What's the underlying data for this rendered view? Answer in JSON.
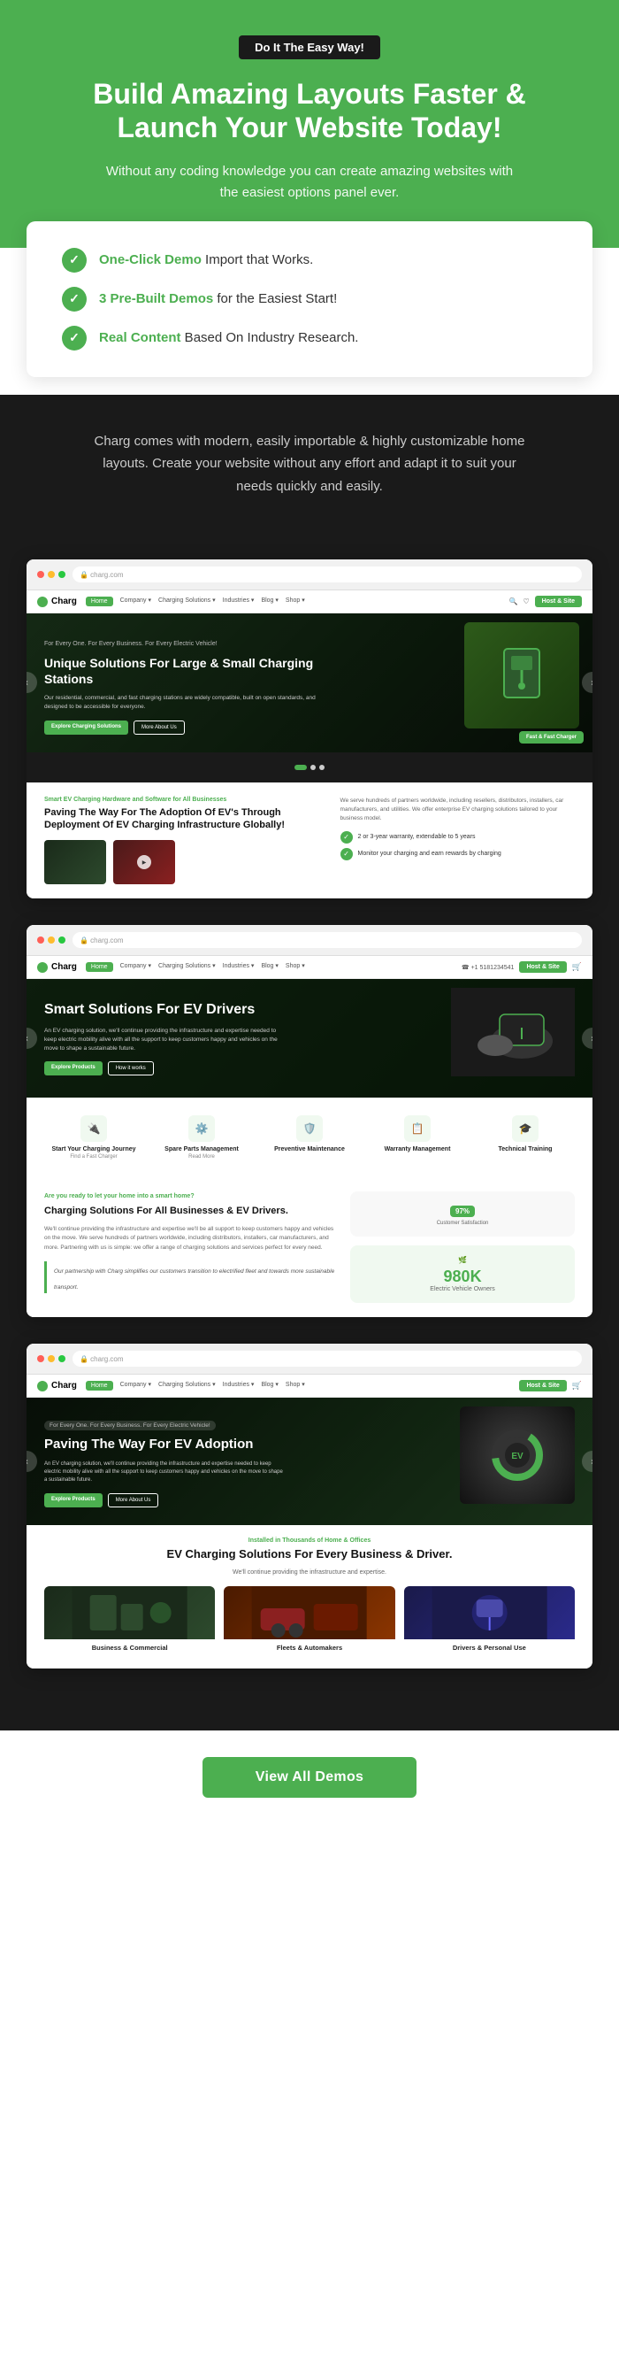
{
  "hero": {
    "badge": "Do It The Easy Way!",
    "title": "Build Amazing Layouts Faster & Launch Your Website Today!",
    "subtitle": "Without any coding knowledge you can create amazing websites with the easiest options panel ever."
  },
  "features": {
    "items": [
      {
        "highlight": "One-Click Demo",
        "text": " Import that Works."
      },
      {
        "highlight": "3 Pre-Built Demos",
        "text": " for the Easiest Start!"
      },
      {
        "highlight": "Real Content",
        "text": " Based On Industry Research."
      }
    ]
  },
  "dark_description": "Charg comes with modern, easily importable & highly customizable home layouts. Create your website without any effort and adapt it to suit your needs quickly and easily.",
  "demos": [
    {
      "id": "demo1",
      "nav": {
        "logo": "Charg",
        "links": [
          "Home",
          "Company",
          "Charging Solutions",
          "Industries",
          "Blog",
          "Shop"
        ],
        "active_link": "Home",
        "right_items": [
          "Search",
          "Host & Site"
        ]
      },
      "hero": {
        "small_text": "For Every One. For Every Business. For Every Electric Vehicle!",
        "title": "Unique Solutions For Large & Small Charging Stations",
        "body": "Our residential, commercial, and fast charging stations are widely compatible, built on open standards, and designed to be accessible for everyone.",
        "btn1": "Explore Charging Solutions",
        "btn2": "More About Us"
      },
      "section2": {
        "label": "Smart EV Charging Hardware and Software for All Businesses",
        "title": "Paving The Way For The Adoption Of EV's Through Deployment Of EV Charging Infrastructure Globally!",
        "body": "We serve hundreds of partners worldwide, including resellers, distributors, installers, car manufacturers, and utilities. We offer enterprise EV charging solutions tailored to your business model.",
        "checks": [
          "2 or 3-year warranty, extendable to 5 years",
          "Monitor your charging and earn rewards by charging"
        ]
      }
    },
    {
      "id": "demo2",
      "nav": {
        "logo": "Charg",
        "links": [
          "Home",
          "Company",
          "Charging Solutions",
          "Industries",
          "Blog",
          "Shop"
        ],
        "active_link": "Home",
        "right_items": [
          "+1 5181234541",
          "Host & Site"
        ]
      },
      "hero": {
        "title": "Smart Solutions For EV Drivers",
        "body": "An EV charging solution, we'll continue providing the infrastructure and expertise needed to keep electric mobility alive with all the support to keep customers happy and vehicles on the move to shape a sustainable future.",
        "btn1": "Explore Products",
        "btn2": "How it works"
      },
      "cards": [
        {
          "icon": "🔧",
          "title": "Start Your Charging Journey",
          "desc": "Find a Fast Charger"
        },
        {
          "icon": "⚙️",
          "title": "Spare Parts Management",
          "desc": "Read More"
        },
        {
          "icon": "🛡️",
          "title": "Preventive Maintenance",
          "desc": ""
        },
        {
          "icon": "📋",
          "title": "Warranty Management",
          "desc": ""
        },
        {
          "icon": "🎓",
          "title": "Technical Training",
          "desc": ""
        }
      ],
      "section2": {
        "label": "Are you ready to let your home into a smart home?",
        "title": "Charging Solutions For All Businesses & EV Drivers.",
        "body": "We'll continue providing the infrastructure and expertise we'll be all support to keep customers happy and vehicles on the move. We serve hundreds of partners worldwide, including distributors, installers, car manufacturers, and more. Partnering with us is simple: we offer a range of charging solutions and services perfect for every need.",
        "quote": "Our partnership with Charg simplifies our customers transition to electrified fleet and towards more sustainable transport.",
        "stats": {
          "percent": "97%",
          "number": "980K",
          "label": "Electric Vehicle Owners"
        }
      }
    },
    {
      "id": "demo3",
      "nav": {
        "logo": "Charg",
        "links": [
          "Home",
          "Company",
          "Charging Solutions",
          "Industries",
          "Blog",
          "Shop"
        ],
        "active_link": "Home",
        "right_items": [
          "Host & Site"
        ]
      },
      "hero": {
        "small_label": "For Every One. For Every Business. For Every Electric Vehicle!",
        "title": "Paving The Way For EV Adoption",
        "body": "An EV charging solution, we'll continue providing the infrastructure and expertise needed to keep electric mobility alive with all the support to keep customers happy and vehicles on the move to shape a sustainable future.",
        "btn1": "Explore Products",
        "btn2": "More About Us"
      },
      "section2": {
        "label": "Installed in Thousands of Home & Offices",
        "title": "EV Charging Solutions For Every Business & Driver.",
        "body": "We'll continue providing the infrastructure and expertise.",
        "cards": [
          {
            "label": "Business & Commercial",
            "type": "dark"
          },
          {
            "label": "Fleets & Automakers",
            "type": "red"
          },
          {
            "label": "Drivers & Personal Use",
            "type": "blue"
          }
        ]
      }
    }
  ],
  "view_all": {
    "label": "View All Demos"
  },
  "colors": {
    "green": "#4caf50",
    "dark": "#1a1a1a",
    "white": "#ffffff"
  }
}
